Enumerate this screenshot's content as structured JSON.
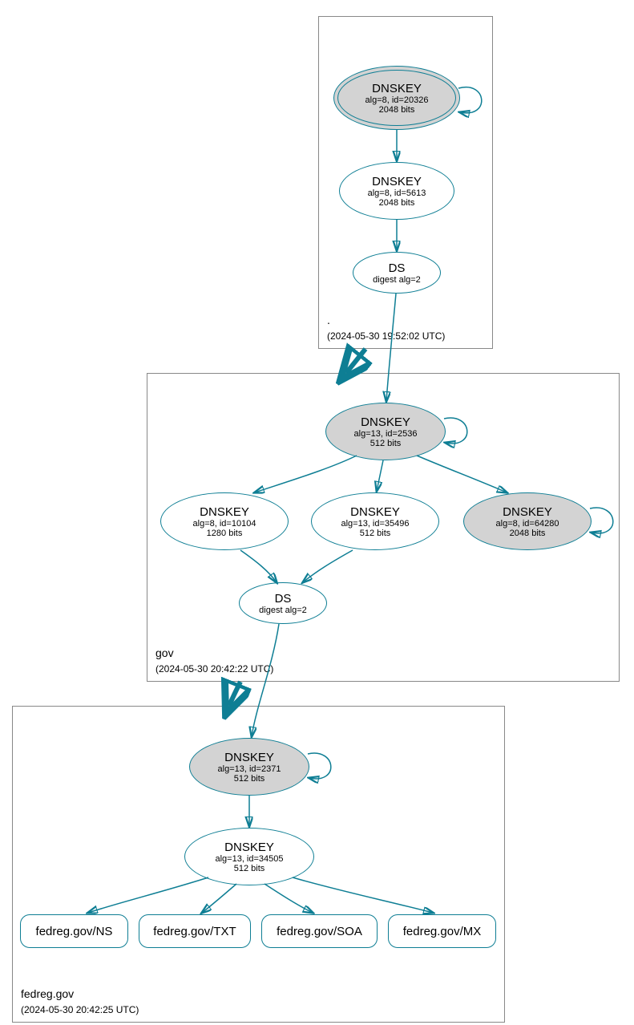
{
  "colors": {
    "stroke": "#0e7e94",
    "node_fill_grey": "#d3d3d3",
    "node_fill_white": "#ffffff",
    "box_border": "#888888"
  },
  "zones": {
    "root": {
      "name": ".",
      "timestamp": "(2024-05-30 19:52:02 UTC)"
    },
    "gov": {
      "name": "gov",
      "timestamp": "(2024-05-30 20:42:22 UTC)"
    },
    "fedreg": {
      "name": "fedreg.gov",
      "timestamp": "(2024-05-30 20:42:25 UTC)"
    }
  },
  "nodes": {
    "root_ksk": {
      "title": "DNSKEY",
      "sub1": "alg=8, id=20326",
      "sub2": "2048 bits"
    },
    "root_zsk": {
      "title": "DNSKEY",
      "sub1": "alg=8, id=5613",
      "sub2": "2048 bits"
    },
    "root_ds": {
      "title": "DS",
      "sub1": "digest alg=2",
      "sub2": ""
    },
    "gov_ksk": {
      "title": "DNSKEY",
      "sub1": "alg=13, id=2536",
      "sub2": "512 bits"
    },
    "gov_k1": {
      "title": "DNSKEY",
      "sub1": "alg=8, id=10104",
      "sub2": "1280 bits"
    },
    "gov_k2": {
      "title": "DNSKEY",
      "sub1": "alg=13, id=35496",
      "sub2": "512 bits"
    },
    "gov_k3": {
      "title": "DNSKEY",
      "sub1": "alg=8, id=64280",
      "sub2": "2048 bits"
    },
    "gov_ds": {
      "title": "DS",
      "sub1": "digest alg=2",
      "sub2": ""
    },
    "fed_ksk": {
      "title": "DNSKEY",
      "sub1": "alg=13, id=2371",
      "sub2": "512 bits"
    },
    "fed_zsk": {
      "title": "DNSKEY",
      "sub1": "alg=13, id=34505",
      "sub2": "512 bits"
    },
    "rr_ns": {
      "label": "fedreg.gov/NS"
    },
    "rr_txt": {
      "label": "fedreg.gov/TXT"
    },
    "rr_soa": {
      "label": "fedreg.gov/SOA"
    },
    "rr_mx": {
      "label": "fedreg.gov/MX"
    }
  }
}
